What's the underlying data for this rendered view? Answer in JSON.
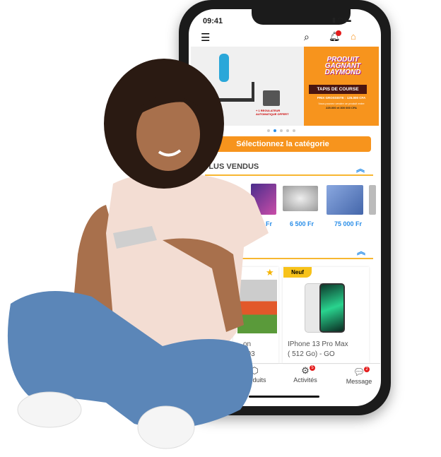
{
  "status_bar": {
    "time": "09:41"
  },
  "header": {
    "icons": [
      "menu-icon",
      "search-icon",
      "bell-icon",
      "logo-icon"
    ],
    "bell_badge": ""
  },
  "banner": {
    "title_lines": [
      "PRODUIT",
      "GAGNANT",
      "DAYMOND"
    ],
    "product": "TAPIS DE COURSE",
    "price_line": "PRIX GROSSISTE : 125.000 CFA",
    "sell_line": "Vous pouvez vendre ce produit entre",
    "range": "225.000 et 300 000 CFA",
    "bonus": "+ 1 REGULATEUR AUTOMATIQUE OFFERT",
    "active_dot": 1,
    "dots": 5
  },
  "category_button": "Sélectionnez la catégorie",
  "best_sellers": {
    "title": "PLUS VENDUS",
    "prices": [
      "Fr",
      "6 500 Fr",
      "75 000 Fr"
    ]
  },
  "cards": [
    {
      "title_lines": [
        "on",
        "003"
      ],
      "favorite": true
    },
    {
      "badge": "Neuf",
      "title_lines": [
        "IPhone 13 Pro Max",
        "( 512 Go) - GO"
      ]
    }
  ],
  "bottom_nav": [
    {
      "label": "Produits",
      "icon": "box-icon"
    },
    {
      "label": "Activités",
      "icon": "briefcase-icon",
      "badge": "5"
    },
    {
      "label": "Message",
      "icon": "chat-icon",
      "badge": "2"
    }
  ],
  "colors": {
    "accent": "#f7941d",
    "link": "#2a8ee8",
    "badge": "#e41b1b"
  }
}
